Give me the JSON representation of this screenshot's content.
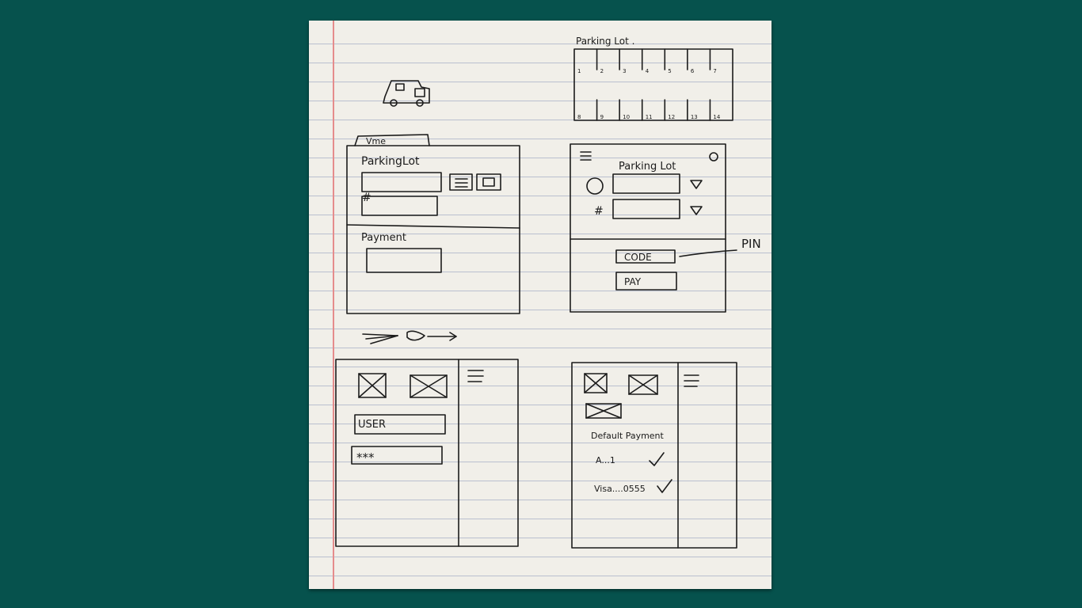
{
  "sketch": {
    "parking_map": {
      "title": "Parking Lot .",
      "top_numbers": [
        "1",
        "2",
        "3",
        "4",
        "5",
        "6",
        "7"
      ],
      "bottom_numbers": [
        "8",
        "9",
        "10",
        "11",
        "12",
        "13",
        "14"
      ]
    },
    "screen_a": {
      "tab_label": "Vme",
      "title": "ParkingLot",
      "hash_label": "#",
      "payment_label": "Payment"
    },
    "screen_b": {
      "title": "Parking Lot",
      "hash_label": "#",
      "code_button": "CODE",
      "pay_button": "PAY",
      "pin_note": "PIN"
    },
    "screen_c": {
      "username_field": "USER",
      "password_field": "***"
    },
    "screen_d": {
      "default_payment_label": "Default Payment",
      "payment_options": [
        "A...1",
        "Visa....0555"
      ]
    }
  }
}
